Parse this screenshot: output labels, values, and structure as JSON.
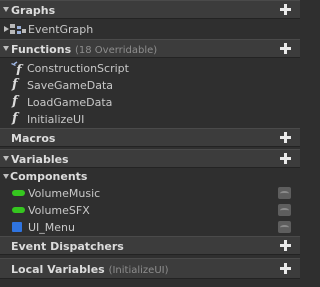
{
  "sections": {
    "graphs": {
      "title": "Graphs",
      "items": [
        {
          "label": "EventGraph",
          "icon": "event-graph-icon"
        }
      ]
    },
    "functions": {
      "title": "Functions",
      "subtitle": "(18 Overridable)",
      "items": [
        {
          "label": "ConstructionScript",
          "icon": "construction-script-icon"
        },
        {
          "label": "SaveGameData",
          "icon": "function-icon"
        },
        {
          "label": "LoadGameData",
          "icon": "function-icon"
        },
        {
          "label": "InitializeUI",
          "icon": "function-icon"
        }
      ]
    },
    "macros": {
      "title": "Macros"
    },
    "variables": {
      "title": "Variables",
      "category": "Components",
      "items": [
        {
          "label": "VolumeMusic",
          "type_color": "#35c61f",
          "icon": "float-variable-icon"
        },
        {
          "label": "VolumeSFX",
          "type_color": "#35c61f",
          "icon": "float-variable-icon"
        },
        {
          "label": "UI_Menu",
          "type_color": "#2f74e0",
          "icon": "object-variable-icon"
        }
      ]
    },
    "event_dispatchers": {
      "title": "Event Dispatchers"
    },
    "local_variables": {
      "title": "Local Variables",
      "subtitle": "(InitializeUI)"
    }
  },
  "colors": {
    "panel_bg": "#2f2f2f",
    "header_bg": "#3c3c3c",
    "text": "#c8c8c8",
    "float_type": "#35c61f",
    "object_type": "#2f74e0"
  }
}
